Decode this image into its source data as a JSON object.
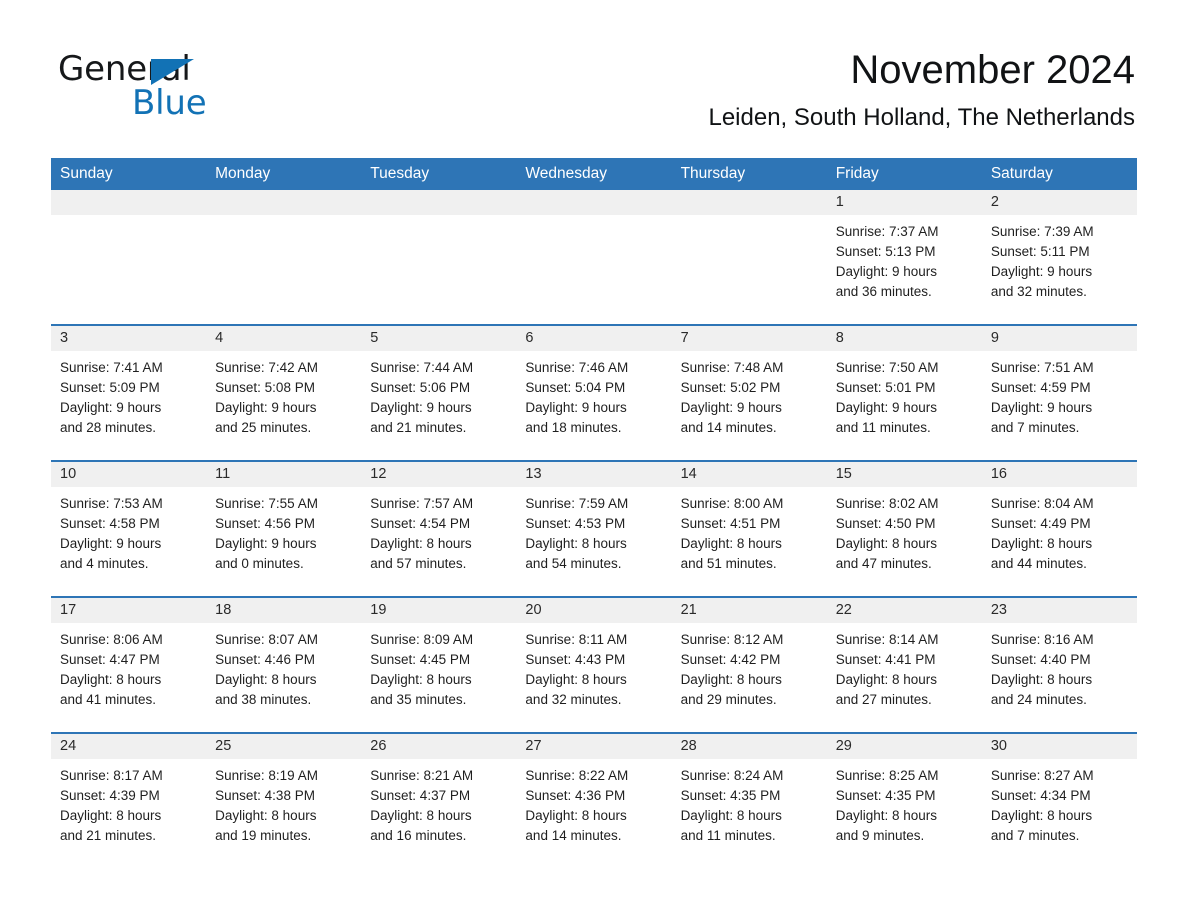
{
  "brand": {
    "word1": "General",
    "word2": "Blue",
    "triangle_color": "#1272b5",
    "logo_icon": "general-blue-triangle-icon"
  },
  "header": {
    "title": "November 2024",
    "subtitle": "Leiden, South Holland, The Netherlands"
  },
  "theme": {
    "header_blue": "#2e75b6",
    "daynum_band": "#f0f0f0",
    "page_background": "#ffffff",
    "text": "#1f1f1f"
  },
  "calendar": {
    "weekdays": [
      "Sunday",
      "Monday",
      "Tuesday",
      "Wednesday",
      "Thursday",
      "Friday",
      "Saturday"
    ],
    "weeks": [
      [
        {
          "day": "",
          "lines": []
        },
        {
          "day": "",
          "lines": []
        },
        {
          "day": "",
          "lines": []
        },
        {
          "day": "",
          "lines": []
        },
        {
          "day": "",
          "lines": []
        },
        {
          "day": "1",
          "lines": [
            "Sunrise: 7:37 AM",
            "Sunset: 5:13 PM",
            "Daylight: 9 hours",
            "and 36 minutes."
          ]
        },
        {
          "day": "2",
          "lines": [
            "Sunrise: 7:39 AM",
            "Sunset: 5:11 PM",
            "Daylight: 9 hours",
            "and 32 minutes."
          ]
        }
      ],
      [
        {
          "day": "3",
          "lines": [
            "Sunrise: 7:41 AM",
            "Sunset: 5:09 PM",
            "Daylight: 9 hours",
            "and 28 minutes."
          ]
        },
        {
          "day": "4",
          "lines": [
            "Sunrise: 7:42 AM",
            "Sunset: 5:08 PM",
            "Daylight: 9 hours",
            "and 25 minutes."
          ]
        },
        {
          "day": "5",
          "lines": [
            "Sunrise: 7:44 AM",
            "Sunset: 5:06 PM",
            "Daylight: 9 hours",
            "and 21 minutes."
          ]
        },
        {
          "day": "6",
          "lines": [
            "Sunrise: 7:46 AM",
            "Sunset: 5:04 PM",
            "Daylight: 9 hours",
            "and 18 minutes."
          ]
        },
        {
          "day": "7",
          "lines": [
            "Sunrise: 7:48 AM",
            "Sunset: 5:02 PM",
            "Daylight: 9 hours",
            "and 14 minutes."
          ]
        },
        {
          "day": "8",
          "lines": [
            "Sunrise: 7:50 AM",
            "Sunset: 5:01 PM",
            "Daylight: 9 hours",
            "and 11 minutes."
          ]
        },
        {
          "day": "9",
          "lines": [
            "Sunrise: 7:51 AM",
            "Sunset: 4:59 PM",
            "Daylight: 9 hours",
            "and 7 minutes."
          ]
        }
      ],
      [
        {
          "day": "10",
          "lines": [
            "Sunrise: 7:53 AM",
            "Sunset: 4:58 PM",
            "Daylight: 9 hours",
            "and 4 minutes."
          ]
        },
        {
          "day": "11",
          "lines": [
            "Sunrise: 7:55 AM",
            "Sunset: 4:56 PM",
            "Daylight: 9 hours",
            "and 0 minutes."
          ]
        },
        {
          "day": "12",
          "lines": [
            "Sunrise: 7:57 AM",
            "Sunset: 4:54 PM",
            "Daylight: 8 hours",
            "and 57 minutes."
          ]
        },
        {
          "day": "13",
          "lines": [
            "Sunrise: 7:59 AM",
            "Sunset: 4:53 PM",
            "Daylight: 8 hours",
            "and 54 minutes."
          ]
        },
        {
          "day": "14",
          "lines": [
            "Sunrise: 8:00 AM",
            "Sunset: 4:51 PM",
            "Daylight: 8 hours",
            "and 51 minutes."
          ]
        },
        {
          "day": "15",
          "lines": [
            "Sunrise: 8:02 AM",
            "Sunset: 4:50 PM",
            "Daylight: 8 hours",
            "and 47 minutes."
          ]
        },
        {
          "day": "16",
          "lines": [
            "Sunrise: 8:04 AM",
            "Sunset: 4:49 PM",
            "Daylight: 8 hours",
            "and 44 minutes."
          ]
        }
      ],
      [
        {
          "day": "17",
          "lines": [
            "Sunrise: 8:06 AM",
            "Sunset: 4:47 PM",
            "Daylight: 8 hours",
            "and 41 minutes."
          ]
        },
        {
          "day": "18",
          "lines": [
            "Sunrise: 8:07 AM",
            "Sunset: 4:46 PM",
            "Daylight: 8 hours",
            "and 38 minutes."
          ]
        },
        {
          "day": "19",
          "lines": [
            "Sunrise: 8:09 AM",
            "Sunset: 4:45 PM",
            "Daylight: 8 hours",
            "and 35 minutes."
          ]
        },
        {
          "day": "20",
          "lines": [
            "Sunrise: 8:11 AM",
            "Sunset: 4:43 PM",
            "Daylight: 8 hours",
            "and 32 minutes."
          ]
        },
        {
          "day": "21",
          "lines": [
            "Sunrise: 8:12 AM",
            "Sunset: 4:42 PM",
            "Daylight: 8 hours",
            "and 29 minutes."
          ]
        },
        {
          "day": "22",
          "lines": [
            "Sunrise: 8:14 AM",
            "Sunset: 4:41 PM",
            "Daylight: 8 hours",
            "and 27 minutes."
          ]
        },
        {
          "day": "23",
          "lines": [
            "Sunrise: 8:16 AM",
            "Sunset: 4:40 PM",
            "Daylight: 8 hours",
            "and 24 minutes."
          ]
        }
      ],
      [
        {
          "day": "24",
          "lines": [
            "Sunrise: 8:17 AM",
            "Sunset: 4:39 PM",
            "Daylight: 8 hours",
            "and 21 minutes."
          ]
        },
        {
          "day": "25",
          "lines": [
            "Sunrise: 8:19 AM",
            "Sunset: 4:38 PM",
            "Daylight: 8 hours",
            "and 19 minutes."
          ]
        },
        {
          "day": "26",
          "lines": [
            "Sunrise: 8:21 AM",
            "Sunset: 4:37 PM",
            "Daylight: 8 hours",
            "and 16 minutes."
          ]
        },
        {
          "day": "27",
          "lines": [
            "Sunrise: 8:22 AM",
            "Sunset: 4:36 PM",
            "Daylight: 8 hours",
            "and 14 minutes."
          ]
        },
        {
          "day": "28",
          "lines": [
            "Sunrise: 8:24 AM",
            "Sunset: 4:35 PM",
            "Daylight: 8 hours",
            "and 11 minutes."
          ]
        },
        {
          "day": "29",
          "lines": [
            "Sunrise: 8:25 AM",
            "Sunset: 4:35 PM",
            "Daylight: 8 hours",
            "and 9 minutes."
          ]
        },
        {
          "day": "30",
          "lines": [
            "Sunrise: 8:27 AM",
            "Sunset: 4:34 PM",
            "Daylight: 8 hours",
            "and 7 minutes."
          ]
        }
      ]
    ]
  }
}
